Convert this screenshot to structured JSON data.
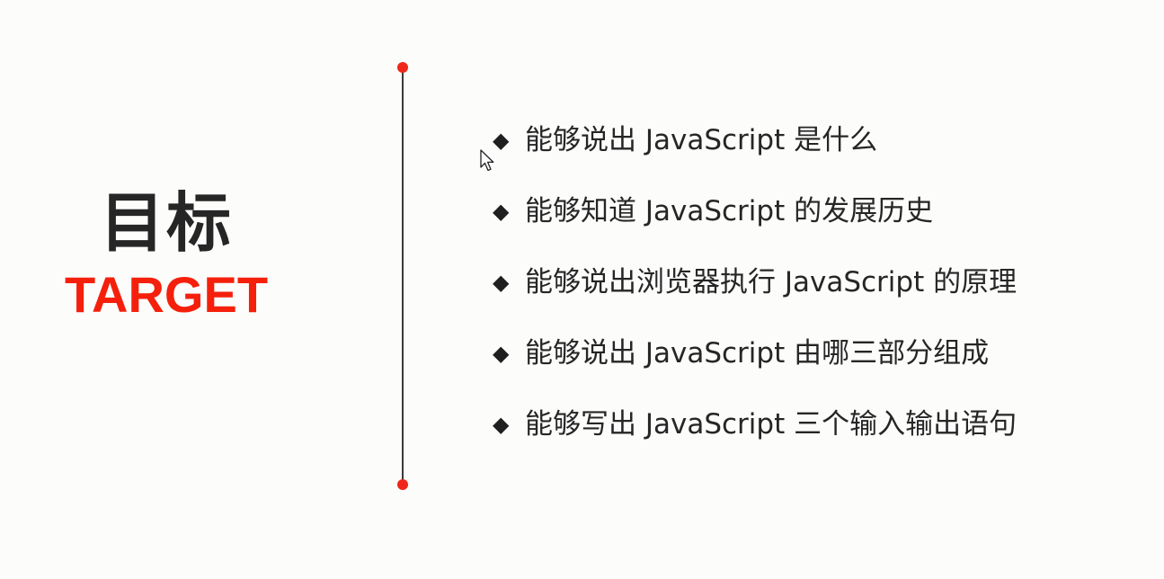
{
  "title": {
    "chinese": "目标",
    "english": "TARGET"
  },
  "colors": {
    "accent": "#f5200c",
    "text": "#262626",
    "line": "#3a3a3a",
    "background": "#fcfcfb"
  },
  "goals": {
    "bullet": "◆",
    "items": [
      "能够说出 JavaScript 是什么",
      "能够知道 JavaScript 的发展历史",
      "能够说出浏览器执行 JavaScript 的原理",
      "能够说出 JavaScript 由哪三部分组成",
      "能够写出 JavaScript 三个输入输出语句"
    ]
  },
  "cursor_icon": "arrow-cursor-icon"
}
